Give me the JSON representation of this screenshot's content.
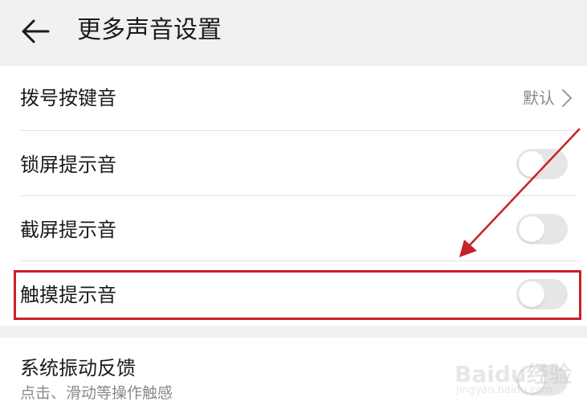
{
  "header": {
    "title": "更多声音设置",
    "back_icon": "arrow-left-icon"
  },
  "settings": [
    {
      "label": "拨号按键音",
      "value": "默认",
      "type": "link"
    },
    {
      "label": "锁屏提示音",
      "type": "toggle",
      "on": false
    },
    {
      "label": "截屏提示音",
      "type": "toggle",
      "on": false
    },
    {
      "label": "触摸提示音",
      "type": "toggle",
      "on": false,
      "highlighted": true
    }
  ],
  "vibration": {
    "label": "系统振动反馈",
    "sublabel": "点击、滑动等操作触感",
    "on": false
  },
  "watermark": {
    "text": "Baidu经验",
    "sub": "jingyan.baidu.com"
  },
  "colors": {
    "highlight": "#c8202a",
    "toggle_off": "#e6e6e6"
  }
}
